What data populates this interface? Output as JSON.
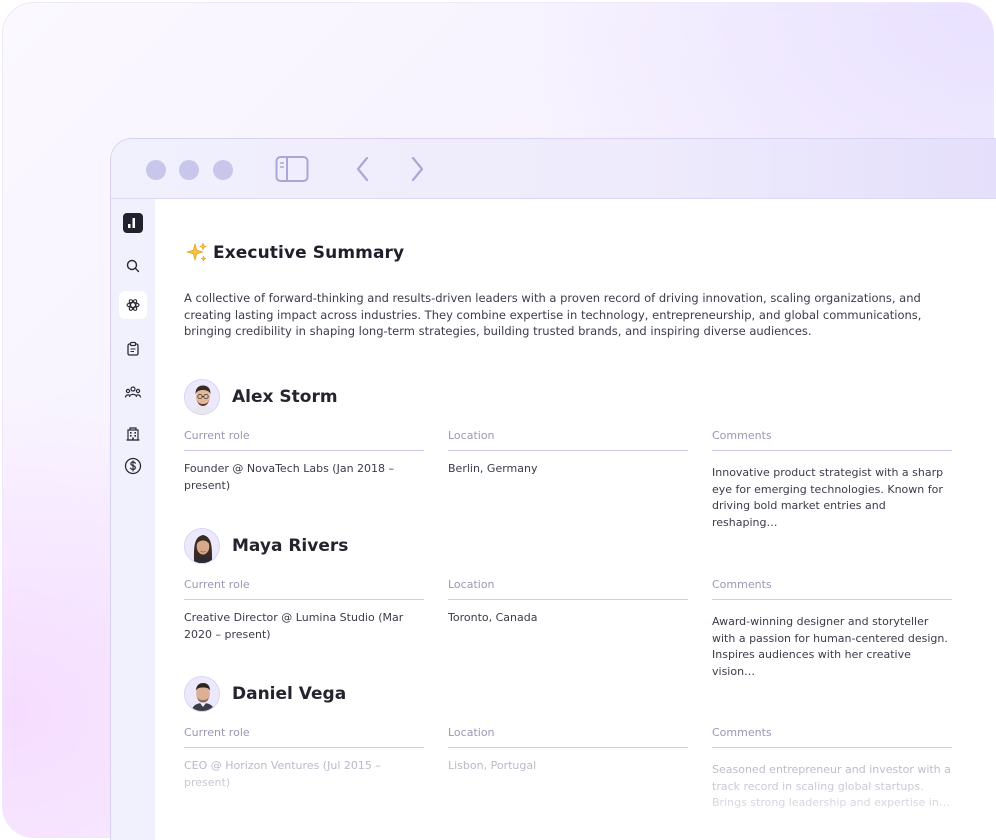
{
  "page": {
    "title": "Executive Summary",
    "summary": "A collective of forward-thinking and results-driven leaders with a proven record of driving innovation, scaling organizations, and creating lasting impact across industries. They combine expertise in technology, entrepreneurship, and global communications, bringing credibility in shaping long-term strategies, building trusted brands, and inspiring diverse audiences."
  },
  "columns": {
    "role": "Current role",
    "location": "Location",
    "comments": "Comments"
  },
  "people": [
    {
      "name": "Alex Storm",
      "role": "Founder @ NovaTech Labs (Jan 2018 – present)",
      "location": "Berlin, Germany",
      "comments": "Innovative product strategist with a sharp eye for emerging technologies. Known for driving bold market entries and reshaping…"
    },
    {
      "name": "Maya Rivers",
      "role": "Creative Director @ Lumina Studio (Mar 2020 – present)",
      "location": "Toronto, Canada",
      "comments": "Award-winning designer and storyteller with a passion for human-centered design. Inspires audiences with her creative vision…"
    },
    {
      "name": "Daniel Vega",
      "role": "CEO @ Horizon Ventures (Jul 2015 – present)",
      "location": "Lisbon, Portugal",
      "comments": "Seasoned entrepreneur and investor with a track record in scaling global startups. Brings strong leadership and expertise in…"
    }
  ],
  "icons": {
    "window_controls": [
      "window-dot",
      "window-dot",
      "window-dot"
    ],
    "toolbar": [
      "sidebar-toggle-icon",
      "back-arrow-icon",
      "forward-arrow-icon"
    ],
    "sidebar": [
      "analytics-logo-icon",
      "search-icon",
      "ai-sparkle-icon",
      "clipboard-icon",
      "people-icon",
      "building-icon",
      "dollar-icon"
    ],
    "title": "sparkles-icon"
  },
  "colors": {
    "accent": "#1f1f2c",
    "titlebar": "#eeebfc",
    "sidebar": "#f1f0fd",
    "control_dot": "#c9c6eb",
    "muted_text": "#9a98b5"
  }
}
